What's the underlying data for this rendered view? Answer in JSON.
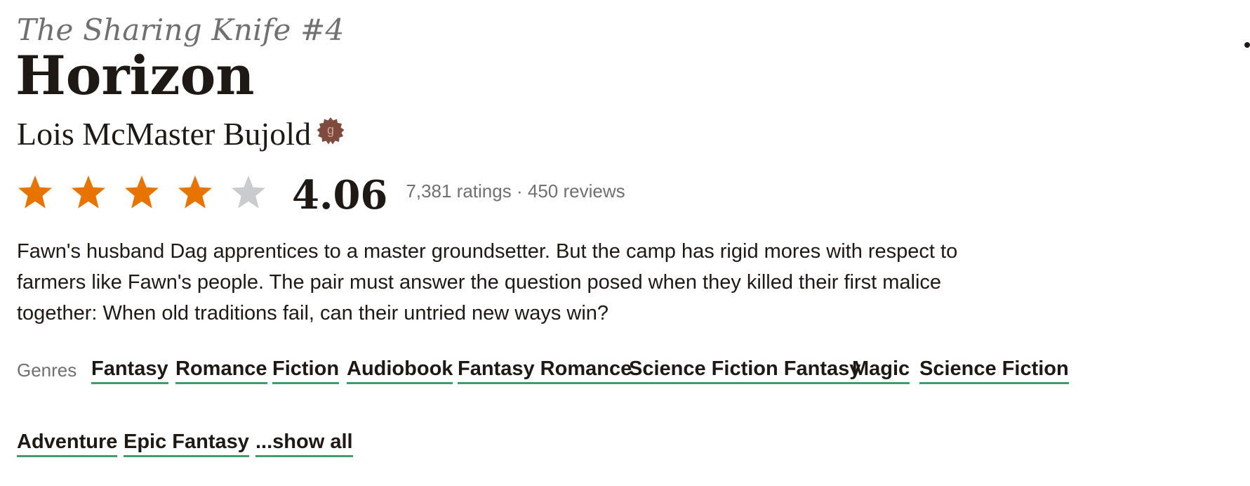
{
  "book": {
    "series": "The Sharing Knife #4",
    "title": "Horizon",
    "author": "Lois McMaster Bujold",
    "author_badge_letter": "g",
    "author_badge_icon": "goodreads-author-badge-icon",
    "rating": {
      "stars_filled": 4,
      "stars_total": 5,
      "average": "4.06",
      "ratings_text": "7,381 ratings",
      "separator": "·",
      "reviews_text": "450 reviews"
    },
    "description": "Fawn's husband Dag apprentices to a master groundsetter. But the camp has rigid mores with respect to farmers like Fawn's people. The pair must answer the question posed when they killed their first malice together: When old traditions fail, can their untried new ways win?",
    "genres_label": "Genres",
    "genres": [
      "Fantasy",
      "Romance",
      "Fiction",
      "Audiobook",
      "Fantasy Romance",
      "Science Fiction Fantasy",
      "Magic",
      "Science Fiction",
      "Adventure",
      "Epic Fantasy"
    ],
    "show_all": "...show all"
  },
  "colors": {
    "star_filled": "#e87400",
    "star_empty": "#c9cbce",
    "genre_underline": "#409d69",
    "badge": "#7f4b3f",
    "text_primary": "#1e1915",
    "text_secondary": "#707070"
  }
}
